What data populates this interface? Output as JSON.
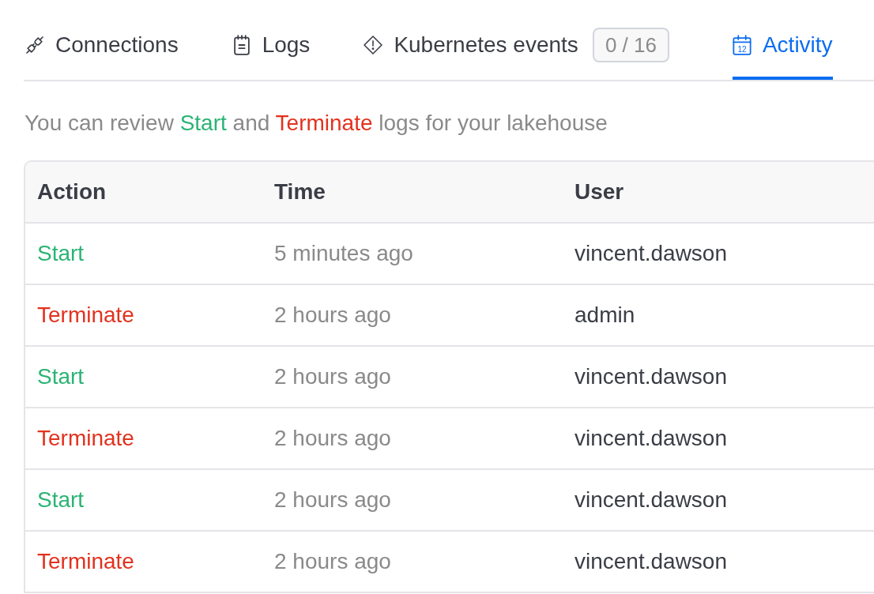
{
  "tabs": [
    {
      "label": "Connections",
      "kind": "connections",
      "selected": false
    },
    {
      "label": "Logs",
      "kind": "logs",
      "selected": false
    },
    {
      "label": "Kubernetes events",
      "kind": "events",
      "badge": "0 / 16",
      "selected": false
    },
    {
      "label": "Activity",
      "kind": "activity",
      "icon_label": "12",
      "selected": true
    }
  ],
  "description": [
    {
      "text": "You can review ",
      "kind": "plain"
    },
    {
      "text": "Start",
      "kind": "start"
    },
    {
      "text": " and ",
      "kind": "plain"
    },
    {
      "text": "Terminate",
      "kind": "terminate"
    },
    {
      "text": " logs for your lakehouse",
      "kind": "plain"
    }
  ],
  "table": {
    "columns": [
      "Action",
      "Time",
      "User"
    ],
    "rows": [
      {
        "action": "Start",
        "kind": "start",
        "time": "5 minutes ago",
        "user": "vincent.dawson"
      },
      {
        "action": "Terminate",
        "kind": "terminate",
        "time": "2 hours ago",
        "user": "admin"
      },
      {
        "action": "Start",
        "kind": "start",
        "time": "2 hours ago",
        "user": "vincent.dawson"
      },
      {
        "action": "Terminate",
        "kind": "terminate",
        "time": "2 hours ago",
        "user": "vincent.dawson"
      },
      {
        "action": "Start",
        "kind": "start",
        "time": "2 hours ago",
        "user": "vincent.dawson"
      },
      {
        "action": "Terminate",
        "kind": "terminate",
        "time": "2 hours ago",
        "user": "vincent.dawson"
      }
    ]
  }
}
